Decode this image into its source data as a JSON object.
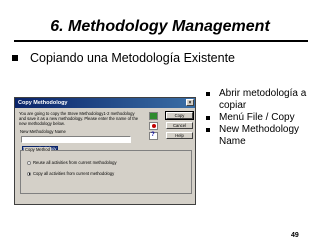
{
  "slide": {
    "title": "6. Methodology Management",
    "main_bullet": "Copiando una Metodología Existente",
    "bullets": [
      "Abrir metodología a copiar",
      "Menú File / Copy",
      "New Methodology Name"
    ],
    "page_number": "49"
  },
  "dialog": {
    "title": "Copy Methodology",
    "close": "×",
    "description": "You are going to copy the Steve Methodology1-2 methodology and save it as a new methodology. Please enter the name of the new methodology below.",
    "name_label": "New Methodology Name",
    "name_value": "New Methodology",
    "group_label": "Copy Method",
    "radio_1": "Reuse all activities from current methodology",
    "radio_2": "Copy all activities from current methodology",
    "radio_selected": 2,
    "buttons": {
      "copy": "Copy",
      "cancel": "Cancel",
      "help": "Help"
    }
  }
}
